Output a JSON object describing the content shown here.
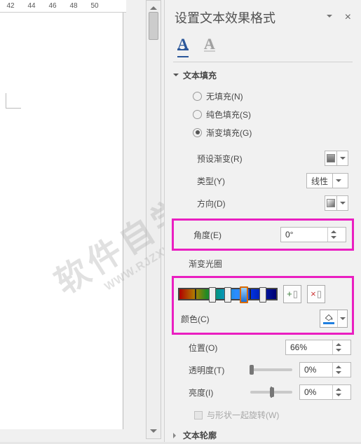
{
  "ruler_ticks": [
    "42",
    "44",
    "46",
    "48",
    "50"
  ],
  "panel_title": "设置文本效果格式",
  "section_fill": "文本填充",
  "section_outline": "文本轮廓",
  "fill": {
    "none": "无填充(N)",
    "solid": "纯色填充(S)",
    "grad": "渐变填充(G)"
  },
  "rows": {
    "preset": "预设渐变(R)",
    "type": "类型(Y)",
    "type_v": "线性",
    "dir": "方向(D)",
    "angle": "角度(E)",
    "angle_v": "0°",
    "stops": "渐变光圈",
    "color": "颜色(C)",
    "pos": "位置(O)",
    "pos_v": "66%",
    "trans": "透明度(T)",
    "trans_v": "0%",
    "bright": "亮度(I)",
    "bright_v": "0%",
    "rotate": "与形状一起旋转(W)"
  },
  "watermark": {
    "big": "软件自学网",
    "small": "WWW.RJZXW.COM"
  }
}
